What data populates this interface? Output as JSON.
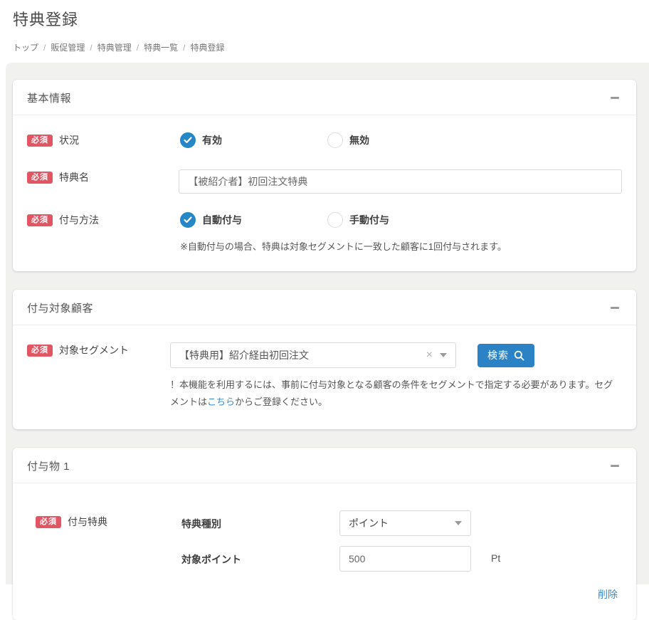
{
  "page": {
    "title": "特典登録",
    "breadcrumb": [
      "トップ",
      "販促管理",
      "特典管理",
      "特典一覧",
      "特典登録"
    ],
    "breadcrumb_separator": "/"
  },
  "colors": {
    "accent_blue": "#2387c8",
    "button_blue": "#2b82c4",
    "badge_red": "#e25563",
    "link_blue": "#3a8bc8",
    "page_bg": "#f1f1f0"
  },
  "labels": {
    "required": "必須"
  },
  "icons": {
    "clear_glyph": "×"
  },
  "card_basic": {
    "title": "基本情報",
    "status_label": "状況",
    "status_option_active": "有効",
    "status_option_inactive": "無効",
    "name_label": "特典名",
    "name_value": "【被紹介者】初回注文特典",
    "method_label": "付与方法",
    "method_option_auto": "自動付与",
    "method_option_manual": "手動付与",
    "method_note": "※自動付与の場合、特典は対象セグメントに一致した顧客に1回付与されます。"
  },
  "card_target": {
    "title": "付与対象顧客",
    "segment_label": "対象セグメント",
    "segment_value": "【特典用】紹介経由初回注文",
    "search_button": "検索",
    "note_before_link": "！本機能を利用するには、事前に付与対象となる顧客の条件をセグメントで指定する必要があります。セグメントは",
    "note_link": "こちら",
    "note_after_link": "からご登録ください。"
  },
  "card_grant": {
    "title": "付与物 1",
    "grant_label": "付与特典",
    "type_label": "特典種別",
    "type_value": "ポイント",
    "points_label": "対象ポイント",
    "points_value": "500",
    "points_unit": "Pt",
    "delete_link": "削除"
  }
}
